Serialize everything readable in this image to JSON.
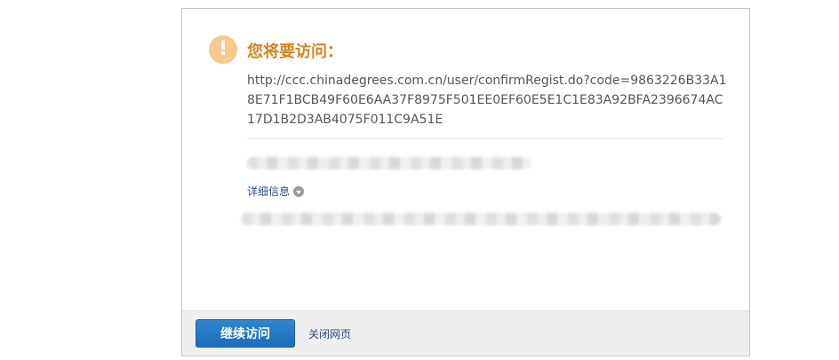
{
  "dialog": {
    "title": "您将要访问：",
    "url": "http://ccc.chinadegrees.com.cn/user/confirmRegist.do?code=9863226B33A18E71F1BCB49F60E6AA37F8975F501EE0EF60E5E1C1E83A92BFA2396674AC17D1B2D3AB4075F011C9A51E",
    "details_label": "详细信息",
    "warning_icon": "exclamation-circle-icon",
    "chevron_icon": "chevron-down-icon"
  },
  "footer": {
    "continue_label": "继续访问",
    "close_label": "关闭网页"
  }
}
